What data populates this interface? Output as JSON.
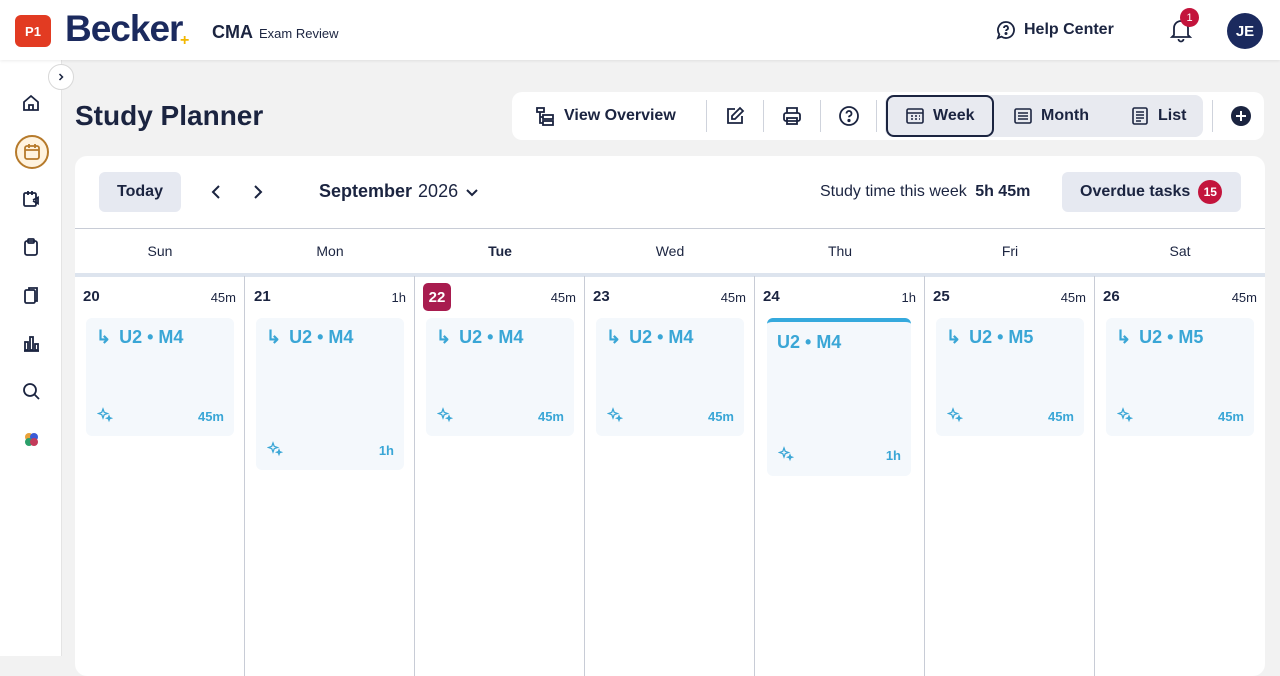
{
  "header": {
    "badge": "P1",
    "logo": "Becker",
    "product": "CMA",
    "product_sub": "Exam Review",
    "help": "Help Center",
    "notif_count": "1",
    "avatar": "JE"
  },
  "sidebar": {
    "items": [
      {
        "icon": "home-icon"
      },
      {
        "icon": "calendar-icon",
        "active": true
      },
      {
        "icon": "calendar-video-icon"
      },
      {
        "icon": "clipboard-icon"
      },
      {
        "icon": "flashcards-icon"
      },
      {
        "icon": "bar-chart-icon"
      },
      {
        "icon": "search-icon"
      },
      {
        "icon": "puzzle-logo-icon"
      }
    ]
  },
  "page": {
    "title": "Study Planner"
  },
  "toolbar": {
    "view_overview": "View Overview",
    "week": "Week",
    "month": "Month",
    "list": "List",
    "active_view": "Week"
  },
  "calendar": {
    "today_label": "Today",
    "month": "September",
    "year": "2026",
    "study_time_label": "Study time this week",
    "study_time_value": "5h 45m",
    "overdue_label": "Overdue tasks",
    "overdue_count": "15",
    "days": [
      {
        "dow": "Sun",
        "date": "20",
        "total": "45m",
        "task": "U2 • M4",
        "task_dur": "45m"
      },
      {
        "dow": "Mon",
        "date": "21",
        "total": "1h",
        "task": "U2 • M4",
        "task_dur": "1h"
      },
      {
        "dow": "Tue",
        "date": "22",
        "total": "45m",
        "task": "U2 • M4",
        "task_dur": "45m",
        "today": true
      },
      {
        "dow": "Wed",
        "date": "23",
        "total": "45m",
        "task": "U2 • M4",
        "task_dur": "45m"
      },
      {
        "dow": "Thu",
        "date": "24",
        "total": "1h",
        "task": "U2 • M4",
        "task_dur": "1h",
        "selected": true
      },
      {
        "dow": "Fri",
        "date": "25",
        "total": "45m",
        "task": "U2 • M5",
        "task_dur": "45m"
      },
      {
        "dow": "Sat",
        "date": "26",
        "total": "45m",
        "task": "U2 • M5",
        "task_dur": "45m"
      }
    ]
  }
}
